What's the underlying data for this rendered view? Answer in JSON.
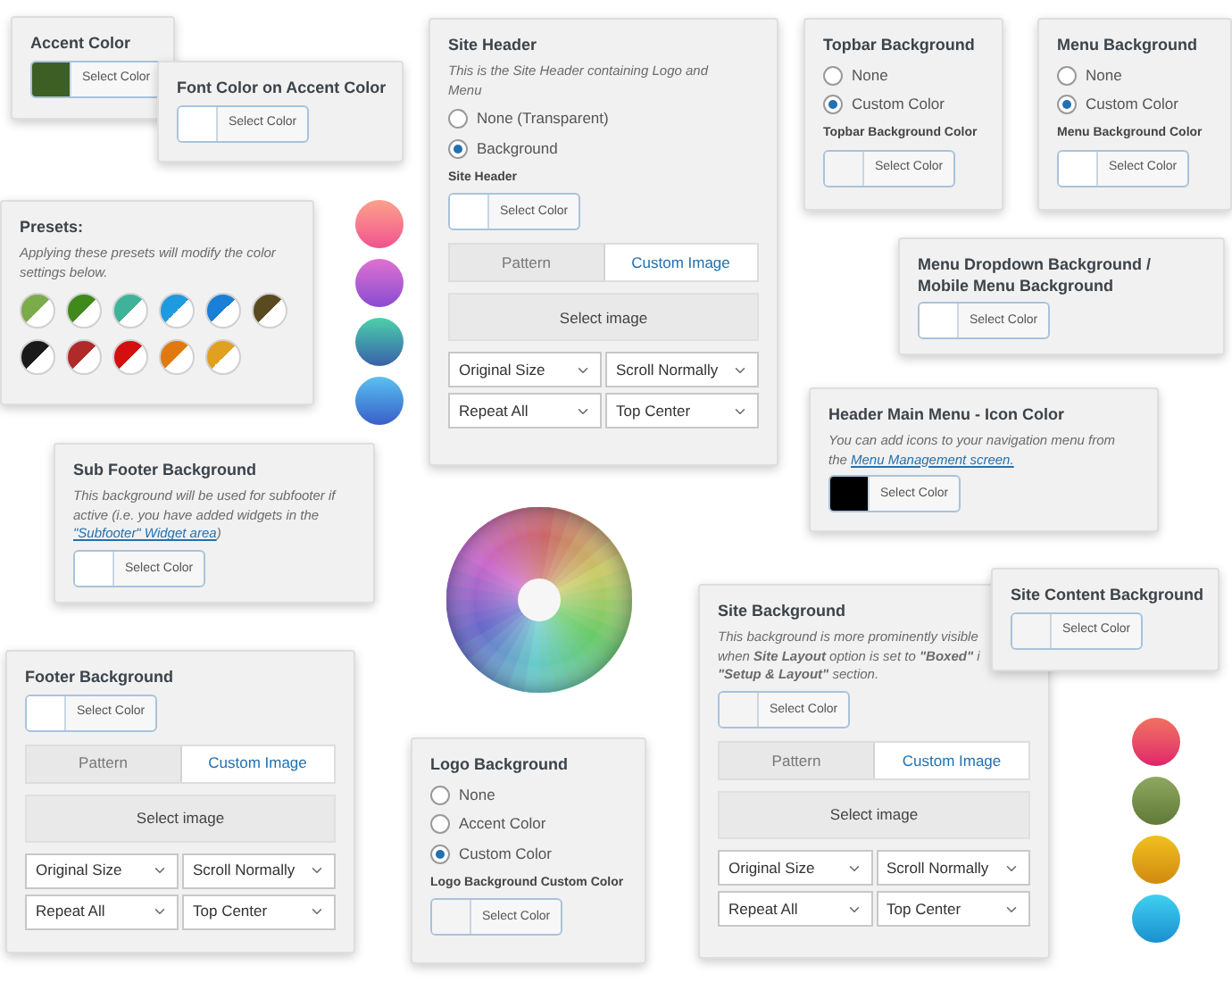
{
  "cards": [
    {
      "kind": "settings",
      "title": "Accent Color",
      "color_picker": {
        "color": "#3d5f26",
        "label": "Select Color"
      }
    },
    {
      "kind": "settings",
      "title": "Font Color on Accent Color",
      "color_picker": {
        "color": "#ffffff",
        "label": "Select Color"
      }
    },
    {
      "kind": "settings",
      "title": "Site Header",
      "description": [
        {
          "kind": "text",
          "text": "This is the Site Header containing Logo and"
        },
        {
          "kind": "break"
        },
        {
          "kind": "text",
          "text": "Menu"
        }
      ],
      "options": [
        {
          "label": "None (Transparent)",
          "selected": false
        },
        {
          "label": "Background",
          "selected": true
        }
      ],
      "sublabel": "Site Header",
      "color_picker": {
        "color": "#ffffff",
        "label": "Select Color"
      },
      "tabs": [
        {
          "label": "Pattern",
          "selected": false
        },
        {
          "label": "Custom Image",
          "selected": true
        }
      ],
      "image_button": "Select image",
      "selects": [
        "Original Size",
        "Scroll Normally",
        "Repeat All",
        "Top Center"
      ]
    },
    {
      "kind": "settings",
      "title": "Topbar Background",
      "options": [
        {
          "label": "None",
          "selected": false
        },
        {
          "label": "Custom Color",
          "selected": true
        }
      ],
      "sublabel": "Topbar Background Color",
      "color_picker": {
        "color": "#f4f4f4",
        "label": "Select Color"
      }
    },
    {
      "kind": "settings",
      "title": "Menu Background",
      "options": [
        {
          "label": "None",
          "selected": false
        },
        {
          "label": "Custom Color",
          "selected": true
        }
      ],
      "sublabel": "Menu Background Color",
      "color_picker": {
        "color": "#ffffff",
        "label": "Select Color"
      }
    },
    {
      "kind": "presets",
      "title": "Presets:",
      "description": [
        {
          "kind": "text",
          "text": "Applying these presets will modify the color"
        },
        {
          "kind": "break"
        },
        {
          "kind": "text",
          "text": "settings below."
        }
      ],
      "swatches": [
        {
          "color": "#7cab4a"
        },
        {
          "color": "#3f8a1a"
        },
        {
          "color": "#3eb39a"
        },
        {
          "color": "#1e9be0"
        },
        {
          "color": "#1a7fd6"
        },
        {
          "color": "#5a4a20"
        },
        {
          "color": "#1a1a1a"
        },
        {
          "color": "#b02a2a"
        },
        {
          "color": "#d40f0f"
        },
        {
          "color": "#e07a10"
        },
        {
          "color": "#e0a020"
        }
      ]
    },
    {
      "kind": "settings",
      "title": "Menu Dropdown Background / Mobile Menu Background",
      "color_picker": {
        "color": "#ffffff",
        "label": "Select Color"
      }
    },
    {
      "kind": "settings",
      "title": "Header Main Menu - Icon Color",
      "description": [
        {
          "kind": "text",
          "text": "You can add icons to your navigation menu from"
        },
        {
          "kind": "break"
        },
        {
          "kind": "text",
          "text": "the "
        },
        {
          "kind": "link",
          "text": "Menu Management screen."
        }
      ],
      "color_picker": {
        "color": "#000000",
        "label": "Select Color"
      }
    },
    {
      "kind": "settings",
      "title": "Sub Footer Background",
      "description": [
        {
          "kind": "text",
          "text": "This background will be used for subfooter if"
        },
        {
          "kind": "break"
        },
        {
          "kind": "text",
          "text": "active (i.e. you have added widgets in the"
        },
        {
          "kind": "break"
        },
        {
          "kind": "link",
          "text": "\"Subfooter\" Widget area"
        },
        {
          "kind": "text",
          "text": ")"
        }
      ],
      "color_picker": {
        "color": "#ffffff",
        "label": "Select Color"
      }
    },
    {
      "kind": "settings",
      "title": "Site Background",
      "description": [
        {
          "kind": "text",
          "text": "This background is more prominently visible"
        },
        {
          "kind": "break"
        },
        {
          "kind": "text",
          "text": "when **Site Layout** option is set to **\"Boxed\"** i"
        },
        {
          "kind": "break"
        },
        {
          "kind": "text",
          "text": "**\"Setup & Layout\"** section."
        }
      ],
      "color_picker": {
        "color": "#f4f4f4",
        "label": "Select Color"
      },
      "tabs": [
        {
          "label": "Pattern",
          "selected": false
        },
        {
          "label": "Custom Image",
          "selected": true
        }
      ],
      "image_button": "Select image",
      "selects": [
        "Original Size",
        "Scroll Normally",
        "Repeat All",
        "Top Center"
      ]
    },
    {
      "kind": "settings",
      "title": "Site Content Background",
      "color_picker": {
        "color": "#f4f4f4",
        "label": "Select Color"
      }
    },
    {
      "kind": "settings",
      "title": "Footer Background",
      "color_picker": {
        "color": "#ffffff",
        "label": "Select Color"
      },
      "tabs": [
        {
          "label": "Pattern",
          "selected": false
        },
        {
          "label": "Custom Image",
          "selected": true
        }
      ],
      "image_button": "Select image",
      "selects": [
        "Original Size",
        "Scroll Normally",
        "Repeat All",
        "Top Center"
      ]
    },
    {
      "kind": "settings",
      "title": "Logo Background",
      "options": [
        {
          "label": "None",
          "selected": false
        },
        {
          "label": "Accent Color",
          "selected": false
        },
        {
          "label": "Custom Color",
          "selected": true
        }
      ],
      "sublabel": "Logo Background Custom Color",
      "color_picker": {
        "color": "#f4f4f4",
        "label": "Select Color"
      }
    }
  ]
}
